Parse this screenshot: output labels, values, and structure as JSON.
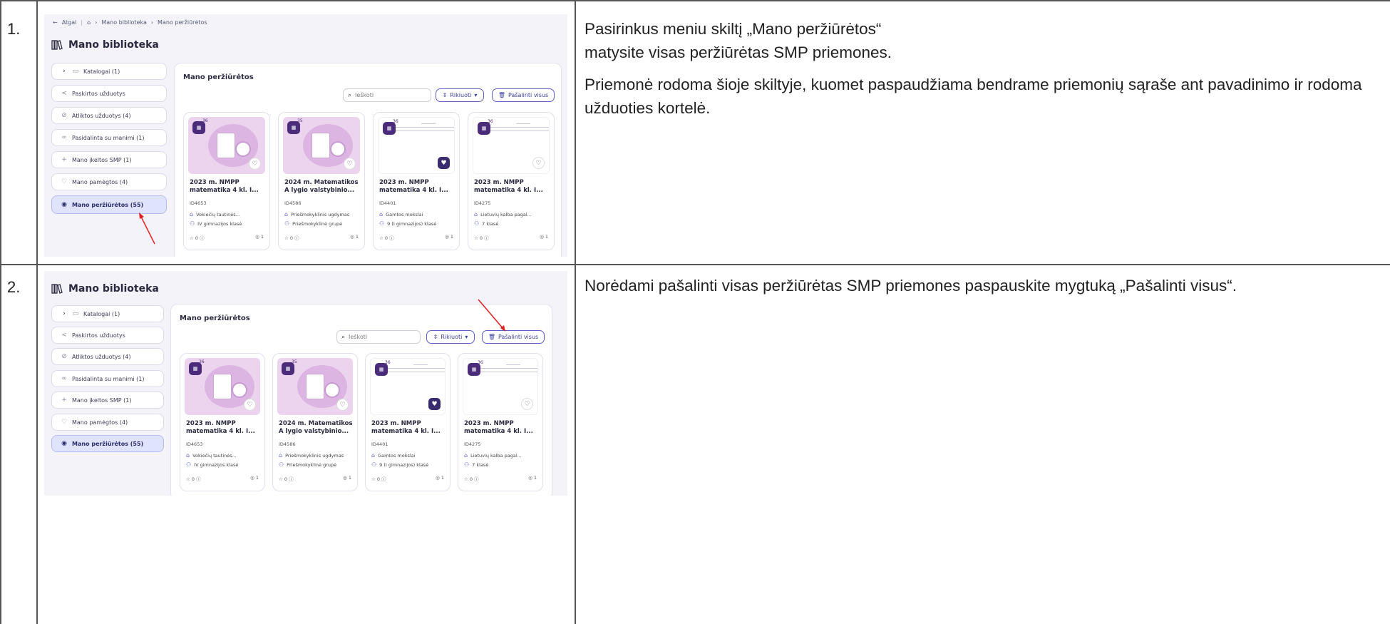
{
  "rows": [
    {
      "number": "1.",
      "paragraphs": [
        "Pasirinkus meniu skiltį „Mano peržiūrėtos“ matysite visas peržiūrėtas SMP priemones.",
        "Priemonė rodoma šioje skiltyje, kuomet paspaudžiama bendrame priemonių sąraše ant pavadinimo ir rodoma užduoties kortelė."
      ]
    },
    {
      "number": "2.",
      "paragraphs": [
        "Norėdami pašalinti visas peržiūrėtas SMP priemones paspauskite mygtuką „Pašalinti visus“."
      ]
    }
  ],
  "breadcrumb": {
    "back": "Atgal",
    "home_icon": "home-icon",
    "items": [
      "Mano biblioteka",
      "Mano peržiūrėtos"
    ]
  },
  "library_title": "Mano biblioteka",
  "sidebar": [
    {
      "label": "Katalogai  (1)",
      "icon": "folder-icon"
    },
    {
      "label": "Paskirtos užduotys",
      "icon": "share-icon"
    },
    {
      "label": "Atliktos užduotys  (4)",
      "icon": "check-circle-icon"
    },
    {
      "label": "Pasidalinta su manimi  (1)",
      "icon": "shared-icon"
    },
    {
      "label": "Mano įkeltos SMP  (1)",
      "icon": "plus-icon"
    },
    {
      "label": "Mano pamėgtos  (4)",
      "icon": "heart-icon"
    },
    {
      "label": "Mano peržiūrėtos  (55)",
      "icon": "eye-icon",
      "active": true
    }
  ],
  "main": {
    "title": "Mano peržiūrėtos",
    "search_placeholder": "Ieškoti",
    "sort_label": "Rikiuoti",
    "remove_all_label": "Pašalinti visus"
  },
  "cards": [
    {
      "title": "2023 m. NMPP matematika 4 kl. I...",
      "id": "ID4653",
      "subject": "Vokiečių tautinės...",
      "grade": "IV gimnazijos klasė",
      "rating": "0",
      "views": "1",
      "number": "36",
      "style": "pink",
      "liked": false
    },
    {
      "title": "2024 m. Matematikos A lygio valstybinio...",
      "id": "ID4586",
      "subject": "Priešmokyklinis ugdymas",
      "grade": "Priešmokyklinė grupė",
      "rating": "0",
      "views": "1",
      "number": "35",
      "style": "pink",
      "liked": false
    },
    {
      "title": "2023 m. NMPP matematika 4 kl. I...",
      "id": "ID4401",
      "subject": "Gamtos mokslai",
      "grade": "9 (I gimnazijos) klasė",
      "rating": "0",
      "views": "1",
      "number": "36",
      "style": "white",
      "liked": true
    },
    {
      "title": "2023 m. NMPP matematika 4 kl. I...",
      "id": "ID4275",
      "subject": "Lietuvių kalba pagal...",
      "grade": "7 klasė",
      "rating": "0",
      "views": "1",
      "number": "36",
      "style": "white",
      "liked": false
    }
  ],
  "colors": {
    "accent": "#5b5fc7",
    "active_bg": "#dfe3fb",
    "arrow": "#e02020",
    "thumb_pink": "#ecd4ee"
  }
}
